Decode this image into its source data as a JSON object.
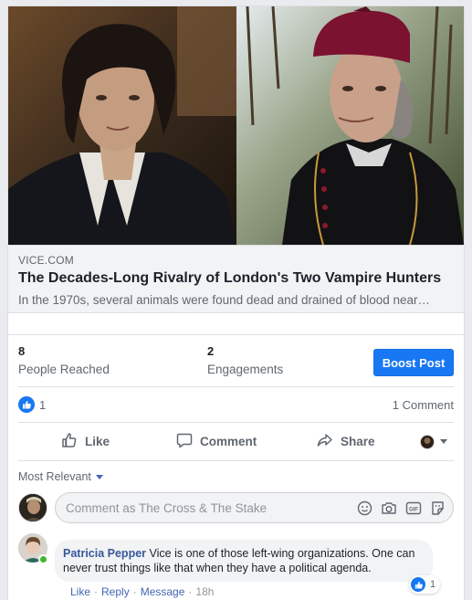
{
  "link_preview": {
    "domain": "VICE.COM",
    "title": "The Decades-Long Rivalry of London's Two Vampire Hunters",
    "description": "In the 1970s, several animals were found dead and drained of blood near…"
  },
  "insights": {
    "people_reached": {
      "value": "8",
      "label": "People Reached"
    },
    "engagements": {
      "value": "2",
      "label": "Engagements"
    },
    "boost_label": "Boost Post"
  },
  "reactions": {
    "like_count": "1",
    "comment_count": "1 Comment"
  },
  "actions": {
    "like": "Like",
    "comment": "Comment",
    "share": "Share"
  },
  "comments_section": {
    "sort_label": "Most Relevant",
    "composer_placeholder": "Comment as The Cross & The Stake",
    "comments": [
      {
        "author": "Patricia Pepper",
        "text": "Vice is one of those left-wing organizations. One can never trust things like that when they have a political agenda.",
        "reaction_count": "1",
        "like_label": "Like",
        "reply_label": "Reply",
        "message_label": "Message",
        "time": "18h",
        "separator": "·"
      }
    ]
  },
  "colors": {
    "accent": "#1877f2",
    "link_blue": "#385898",
    "online_green": "#42b72a",
    "bishop_red": "#7a1230"
  },
  "icons": [
    "like-icon",
    "comment-icon",
    "share-icon",
    "emoji-icon",
    "camera-icon",
    "gif-icon",
    "sticker-icon",
    "thumbs-up-icon",
    "chevron-down-icon"
  ]
}
